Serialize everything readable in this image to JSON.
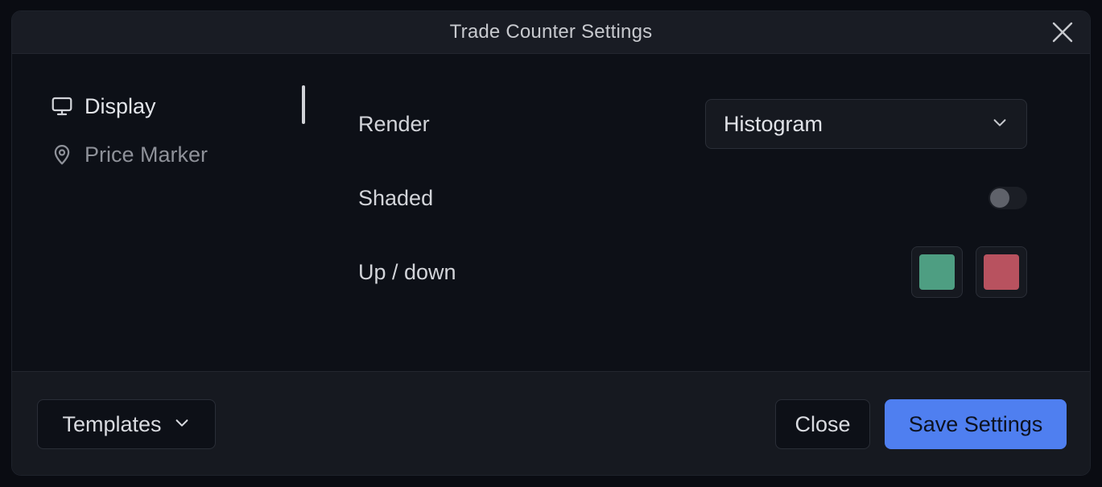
{
  "dialog": {
    "title": "Trade Counter Settings",
    "close_icon": "close-icon"
  },
  "sidebar": {
    "items": [
      {
        "label": "Display",
        "icon": "monitor-icon",
        "active": true
      },
      {
        "label": "Price Marker",
        "icon": "map-pin-icon",
        "active": false
      }
    ]
  },
  "settings": {
    "render": {
      "label": "Render",
      "value": "Histogram",
      "icon": "chevron-down-icon"
    },
    "shaded": {
      "label": "Shaded",
      "enabled": false
    },
    "up_down": {
      "label": "Up / down",
      "up_color": "#4e9e82",
      "down_color": "#b8525f"
    }
  },
  "footer": {
    "templates_label": "Templates",
    "close_label": "Close",
    "save_label": "Save Settings"
  },
  "colors": {
    "accent": "#4f7ff0",
    "background": "#0d1017",
    "titlebar": "#191c24"
  }
}
